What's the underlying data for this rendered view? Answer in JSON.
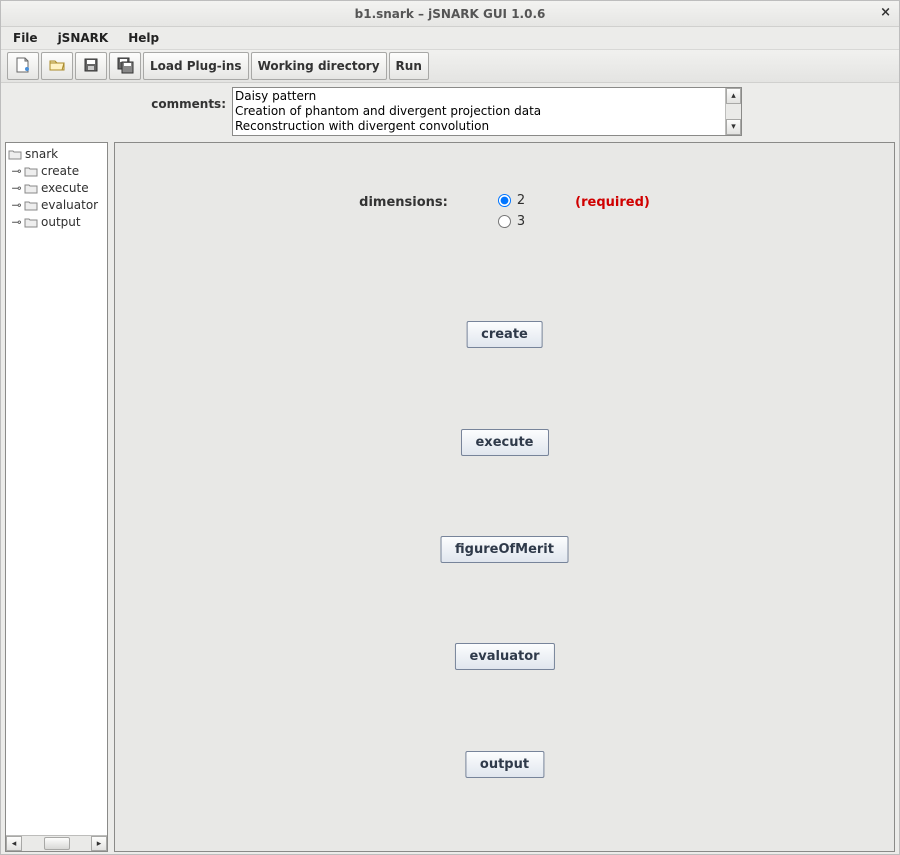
{
  "title": "b1.snark – jSNARK GUI 1.0.6",
  "menubar": [
    "File",
    "jSNARK",
    "Help"
  ],
  "toolbar": {
    "load_plugins": "Load Plug-ins",
    "working_dir": "Working directory",
    "run": "Run"
  },
  "comments": {
    "label": "comments:",
    "text": "Daisy pattern\nCreation of phantom and divergent projection data\nReconstruction with divergent convolution"
  },
  "tree": {
    "root": "snark",
    "children": [
      "create",
      "execute",
      "evaluator",
      "output"
    ]
  },
  "main": {
    "dimensions_label": "dimensions:",
    "required_label": "(required)",
    "dim_options": [
      "2",
      "3"
    ],
    "dim_selected": "2",
    "actions": {
      "create": "create",
      "execute": "execute",
      "fom": "figureOfMerit",
      "evaluator": "evaluator",
      "output": "output"
    }
  }
}
